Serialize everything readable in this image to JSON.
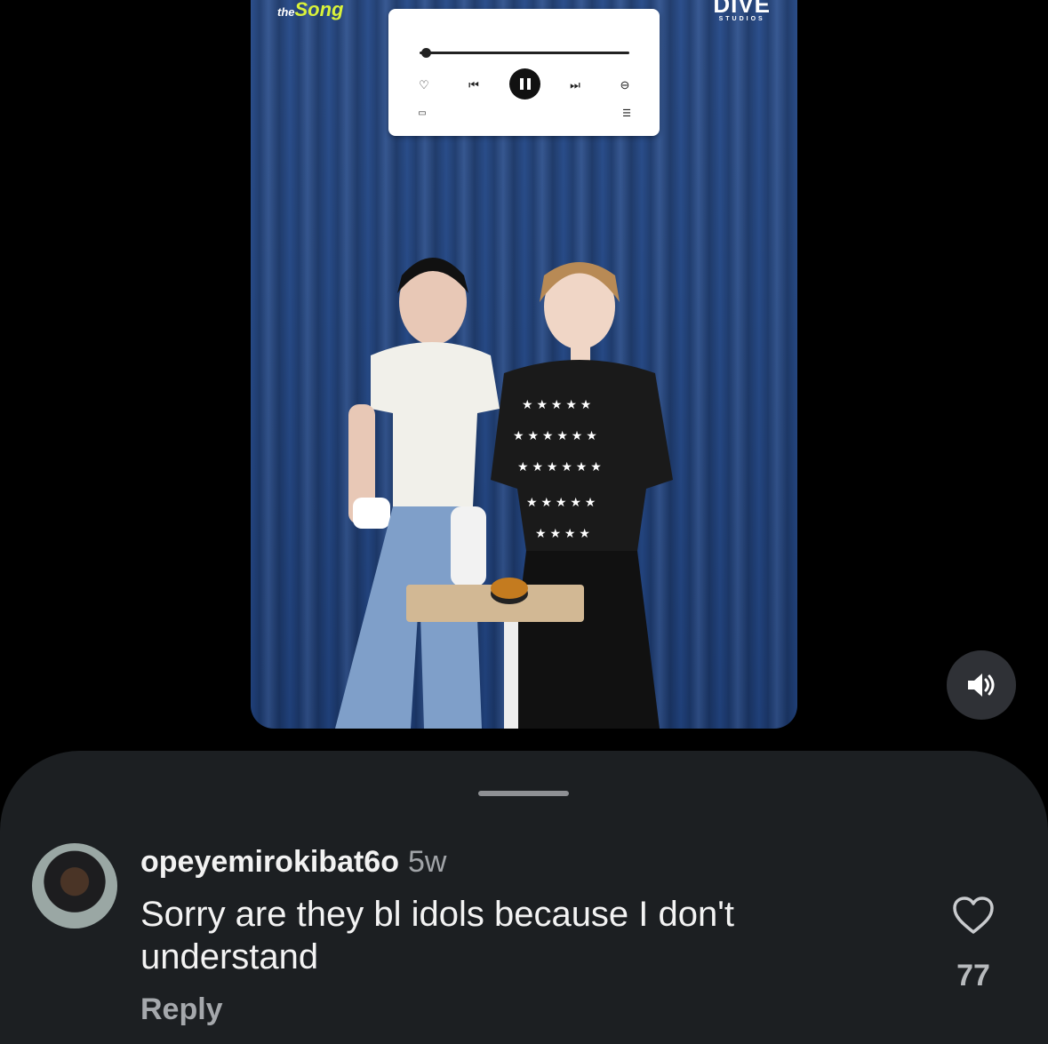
{
  "video": {
    "logo_left_small": "the",
    "logo_left_big": "Song",
    "logo_right_big": "DIVE",
    "logo_right_sub": "STUDIOS"
  },
  "player": {
    "progress": 0.03,
    "icons": [
      "heart-icon",
      "previous-icon",
      "pause-icon",
      "next-icon",
      "minus-circle-icon",
      "device-icon",
      "queue-icon"
    ]
  },
  "sound": {
    "icon": "speaker-icon"
  },
  "comment": {
    "username": "opeyemirokibat6o",
    "time": "5w",
    "text": "Sorry are they bl idols because I don't understand",
    "reply_label": "Reply",
    "likes": "77"
  }
}
